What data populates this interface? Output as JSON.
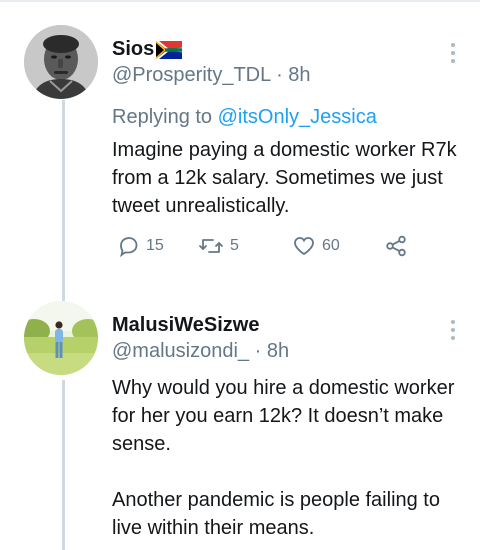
{
  "tweets": [
    {
      "display_name": "Sios",
      "handle": "@Prosperity_TDL",
      "separator": "·",
      "time": "8h",
      "reply_prefix": "Replying to",
      "reply_mention": "@itsOnly_Jessica",
      "text": "Imagine paying a domestic worker R7k from a 12k salary. Sometimes we just tweet unrealistically.",
      "stats": {
        "replies": "15",
        "retweets": "5",
        "likes": "60"
      }
    },
    {
      "display_name": "MalusiWeSizwe",
      "handle": "@malusizondi_",
      "separator": "·",
      "time": "8h",
      "text": "Why would you hire a domestic worker for her you earn 12k? It doesn’t make sense.\n\nAnother pandemic is people failing to live within their means."
    }
  ],
  "icons": {
    "flag": "south-africa-flag-icon",
    "reply": "reply-icon",
    "retweet": "retweet-icon",
    "like": "heart-icon",
    "share": "share-icon",
    "more": "more-vertical-icon"
  },
  "colors": {
    "text": "#14171a",
    "secondary": "#657786",
    "mention": "#1da1f2",
    "thread_line": "#cfd9de"
  }
}
